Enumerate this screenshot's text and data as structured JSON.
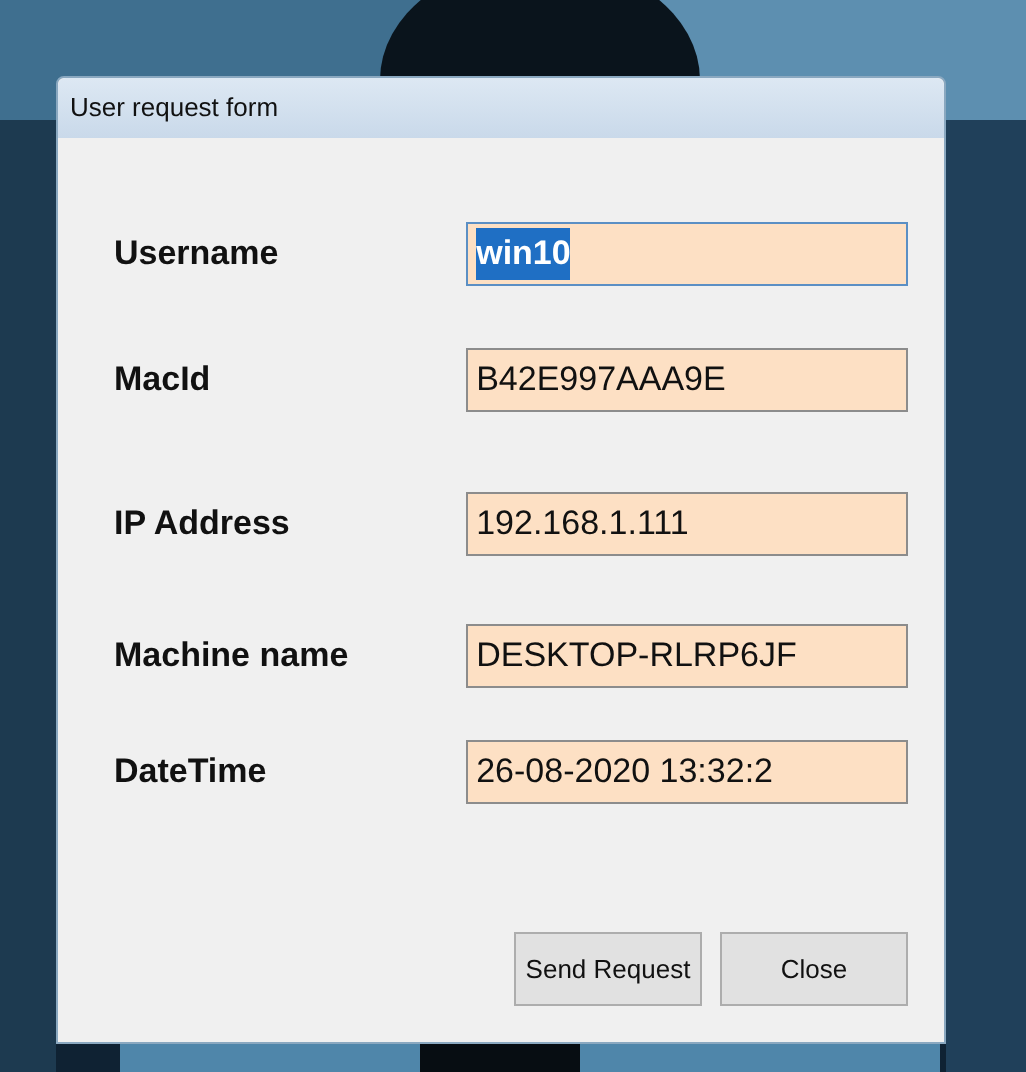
{
  "window": {
    "title": "User request form"
  },
  "fields": [
    {
      "label": "Username",
      "value": "win10",
      "highlighted": true
    },
    {
      "label": "MacId",
      "value": "B42E997AAA9E",
      "highlighted": false
    },
    {
      "label": "IP Address",
      "value": "192.168.1.111",
      "highlighted": false
    },
    {
      "label": "Machine name",
      "value": "DESKTOP-RLRP6JF",
      "highlighted": false
    },
    {
      "label": "DateTime",
      "value": "26-08-2020 13:32:2",
      "highlighted": false
    }
  ],
  "buttons": [
    "Send Request",
    "Close"
  ]
}
